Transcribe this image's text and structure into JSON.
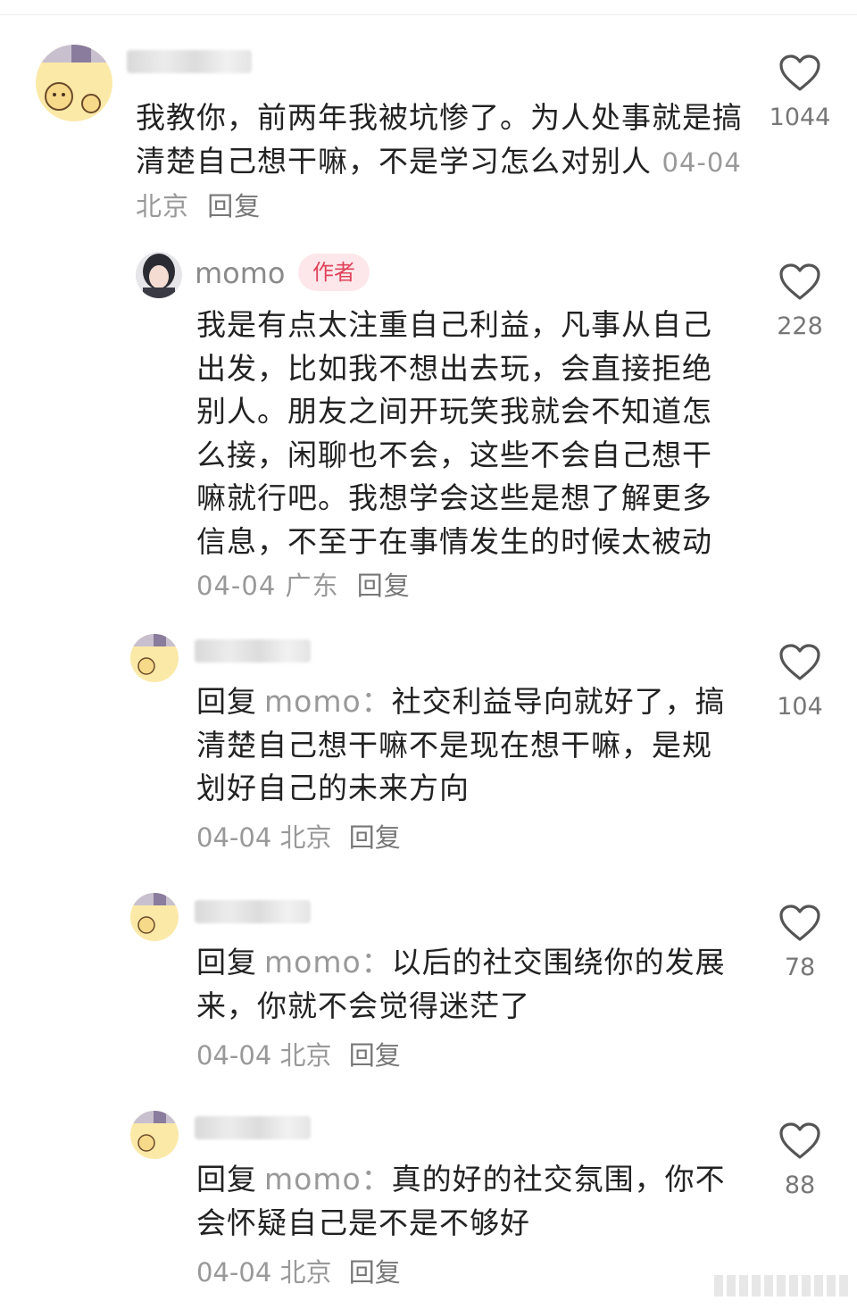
{
  "comments": [
    {
      "text": "我教你，前两年我被坑惨了。为人处事就是搞清楚自己想干嘛，不是学习怎么对别人",
      "date": "04-04",
      "location": "北京",
      "reply_label": "回复",
      "likes": "1044"
    },
    {
      "username": "momo",
      "badge": "作者",
      "text": "我是有点太注重自己利益，凡事从自己出发，比如我不想出去玩，会直接拒绝别人。朋友之间开玩笑我就会不知道怎么接，闲聊也不会，这些不会自己想干嘛就行吧。我想学会这些是想了解更多信息，不至于在事情发生的时候太被动",
      "date": "04-04",
      "location": "广东",
      "reply_label": "回复",
      "likes": "228"
    },
    {
      "reply_prefix": "回复",
      "reply_target": "momo：",
      "text": "社交利益导向就好了，搞清楚自己想干嘛不是现在想干嘛，是规划好自己的未来方向",
      "date": "04-04",
      "location": "北京",
      "reply_label": "回复",
      "likes": "104"
    },
    {
      "reply_prefix": "回复",
      "reply_target": "momo：",
      "text": "以后的社交围绕你的发展来，你就不会觉得迷茫了",
      "date": "04-04",
      "location": "北京",
      "reply_label": "回复",
      "likes": "78"
    },
    {
      "reply_prefix": "回复",
      "reply_target": "momo：",
      "text": "真的好的社交氛围，你不会怀疑自己是不是不够好",
      "date": "04-04",
      "location": "北京",
      "reply_label": "回复",
      "likes": "88"
    }
  ],
  "icons": {
    "like": "heart-outline-icon"
  },
  "colors": {
    "badge_bg": "#fde7ea",
    "badge_text": "#e0435b",
    "meta": "#999999"
  }
}
